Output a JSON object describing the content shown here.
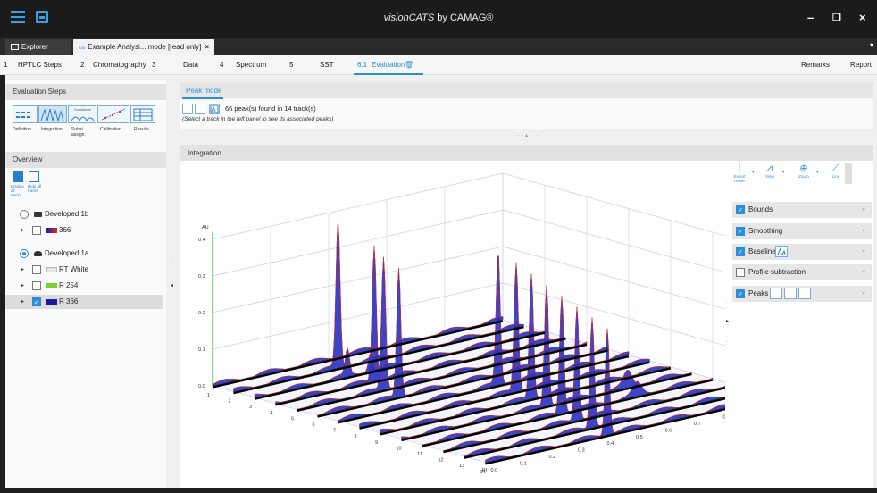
{
  "app": {
    "title_italic": "visionCATS",
    "title_rest": " by CAMAG®",
    "window_controls": {
      "minimize": "–",
      "restore": "❐",
      "close": "×"
    }
  },
  "doc_tabs": {
    "explorer_label": "Explorer",
    "active_prefix": "A48",
    "active_label": "Example Analysi... mode [read only]",
    "close": "×",
    "more": "▾"
  },
  "steps": [
    {
      "num": "1",
      "label": "HPTLC Steps"
    },
    {
      "num": "2",
      "label": "Chromatography"
    },
    {
      "num": "3",
      "label": "Data"
    },
    {
      "num": "4",
      "label": "Spectrum"
    },
    {
      "num": "5",
      "label": "SST"
    },
    {
      "num": "6.1",
      "label": "Evaluation"
    }
  ],
  "step_right": {
    "remarks": "Remarks",
    "report": "Report"
  },
  "evaluation_steps": {
    "header": "Evaluation Steps",
    "labels": [
      "Definition",
      "Integration",
      "Subst. assign.",
      "Calibration",
      "Results"
    ],
    "substance_tag": "Substance"
  },
  "overview": {
    "header": "Overview",
    "display_all": "Display all tracks",
    "hide_all": "Hide all tracks",
    "plates": [
      {
        "name": "Developed 1b",
        "selected": false
      },
      {
        "name": "Developed 1a",
        "selected": true
      }
    ],
    "tracks_1b": [
      {
        "label": "366",
        "checked": false,
        "color": "#d03030"
      }
    ],
    "tracks_1a": [
      {
        "label": "RT White",
        "checked": false,
        "color": "#e8e8e8"
      },
      {
        "label": "R 254",
        "checked": false,
        "color": "#7ad030"
      },
      {
        "label": "R 366",
        "checked": true,
        "color": "#1a1aa0"
      }
    ]
  },
  "peak_mode": {
    "tab": "Peak mode",
    "count_text": "66 peak(s) found in 14 track(s)",
    "hint": "(Select a track in the left panel to see its associated peaks)"
  },
  "integration": {
    "header": "Integration",
    "left_axis_unit": "AU",
    "right_axis_unit": "AU",
    "left_ticks": [
      "0.0",
      "0.1",
      "0.2",
      "0.3",
      "0.4"
    ],
    "right_ticks": [
      "0.0",
      "0.1",
      "0.2",
      "0.3",
      "0.4"
    ],
    "track_numbers": [
      "1",
      "2",
      "3",
      "4",
      "5",
      "6",
      "7",
      "8",
      "9",
      "10",
      "11",
      "12",
      "13",
      "14"
    ],
    "rf_label": "Rf",
    "rf_ticks": [
      "0.0",
      "0.1",
      "0.2",
      "0.3",
      "0.4",
      "0.5",
      "0.6",
      "0.7",
      "0.8",
      "0.9",
      "1.0"
    ]
  },
  "tools": [
    {
      "glyph": "⫶",
      "label": "Expert mode"
    },
    {
      "glyph": "⩘",
      "label": "View"
    },
    {
      "glyph": "⊕",
      "label": "Zoom"
    },
    {
      "glyph": "⟋",
      "label": "Line"
    }
  ],
  "options": [
    {
      "label": "Bounds",
      "checked": true
    },
    {
      "label": "Smoothing",
      "checked": true
    },
    {
      "label": "Baseline",
      "checked": true
    },
    {
      "label": "Profile subtraction",
      "checked": false
    },
    {
      "label": "Peaks",
      "checked": true
    }
  ],
  "colors": {
    "accent": "#2a8fd8",
    "peak_fill": "#2b34c8",
    "peak_edge": "#d03030",
    "axis_green": "#35c235"
  }
}
